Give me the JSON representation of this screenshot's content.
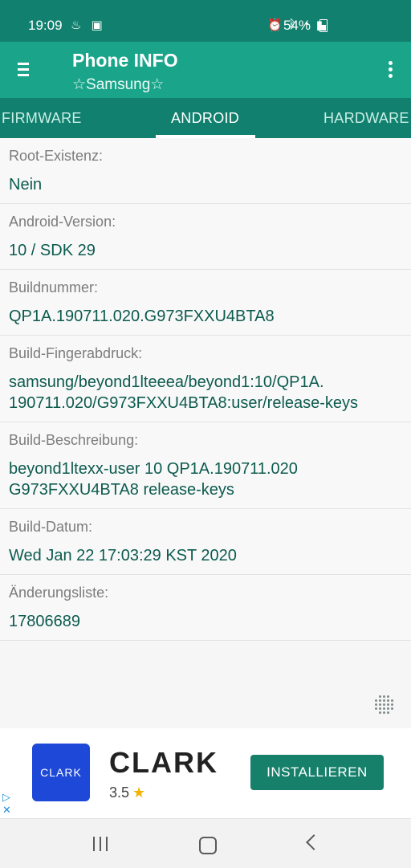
{
  "status_bar": {
    "time": "19:09",
    "battery": "54%",
    "icons_left": [
      "notification-icon",
      "image-icon"
    ],
    "icons_right": [
      "alarm-icon",
      "bluetooth-icon",
      "wifi-icon",
      "signal-icon"
    ]
  },
  "app_bar": {
    "title": "Phone INFO",
    "subtitle": "☆Samsung☆"
  },
  "tabs": {
    "left": "FIRMWARE",
    "active": "ANDROID",
    "right": "HARDWARE"
  },
  "rows": [
    {
      "label": "Root-Existenz:",
      "value": "Nein"
    },
    {
      "label": "Android-Version:",
      "value": "10 / SDK 29"
    },
    {
      "label": "Buildnummer:",
      "value": "QP1A.190711.020.G973FXXU4BTA8"
    },
    {
      "label": "Build-Fingerabdruck:",
      "value_line1": "samsung/beyond1lteeea/beyond1:10/QP1A.",
      "value_line2": "190711.020/G973FXXU4BTA8:user/release-keys"
    },
    {
      "label": "Build-Beschreibung:",
      "value_line1": "beyond1ltexx-user 10 QP1A.190711.020",
      "value_line2": "G973FXXU4BTA8 release-keys"
    },
    {
      "label": "Build-Datum:",
      "value": "Wed Jan 22 17:03:29 KST 2020"
    },
    {
      "label": "Änderungsliste:",
      "value": "17806689"
    }
  ],
  "ad": {
    "logo_text": "CLARK",
    "name": "CLARK",
    "rating": "3.5",
    "button": "INSTALLIEREN",
    "brand_color": "#1e49d8",
    "button_color": "#16806a"
  },
  "colors": {
    "primary_dark": "#12806f",
    "primary": "#1aa58b",
    "value_text": "#0d5b4f"
  }
}
